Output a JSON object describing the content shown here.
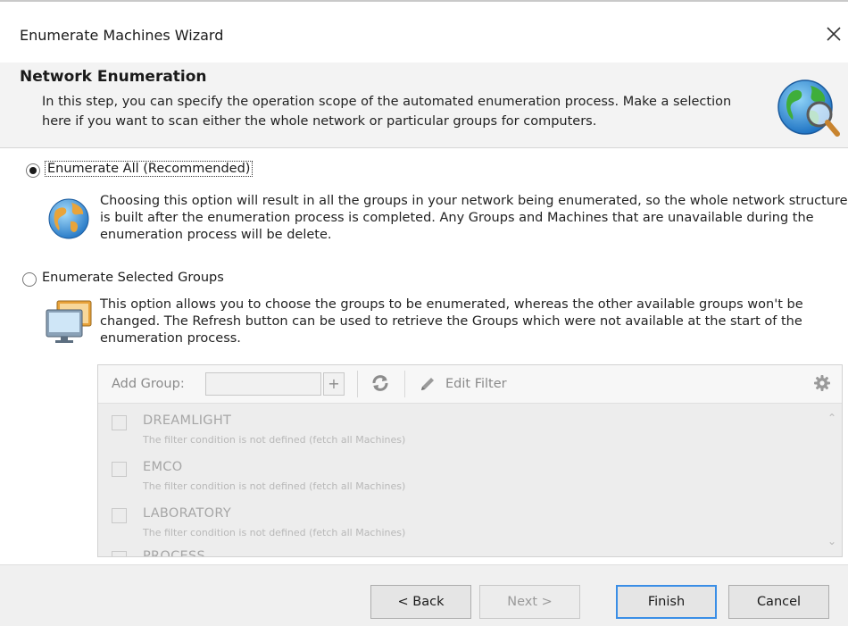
{
  "window": {
    "title": "Enumerate Machines Wizard",
    "close_icon": "close-icon"
  },
  "header": {
    "title": "Network Enumeration",
    "description": "In this step, you can specify the operation scope of the automated enumeration process. Make a selection here if you want to scan either the whole network or particular groups for computers.",
    "icon": "globe-magnifier-icon"
  },
  "options": {
    "enumerate_all": {
      "label": "Enumerate All (Recommended)",
      "selected": true,
      "description": "Choosing this option will result in all the groups in your network being enumerated, so the whole network structure is built after the enumeration process is completed. Any Groups and Machines that are unavailable during the enumeration process will be delete.",
      "icon": "globe-icon"
    },
    "enumerate_selected": {
      "label": "Enumerate Selected Groups",
      "selected": false,
      "description": "This option allows you to choose the groups to be enumerated, whereas the other available groups won't be changed. The Refresh button can be used to retrieve the Groups which were not available at the start of the enumeration process.",
      "icon": "monitors-icon"
    }
  },
  "group_panel": {
    "add_group_label": "Add Group:",
    "add_group_value": "",
    "add_button": "+",
    "edit_filter_label": "Edit Filter",
    "groups": [
      {
        "name": "DREAMLIGHT",
        "subtitle": "The filter condition is not defined (fetch all Machines)"
      },
      {
        "name": "EMCO",
        "subtitle": "The filter condition is not defined (fetch all Machines)"
      },
      {
        "name": "LABORATORY",
        "subtitle": "The filter condition is not defined (fetch all Machines)"
      },
      {
        "name": "PROCESS",
        "subtitle": ""
      }
    ]
  },
  "footer": {
    "back_label": "< Back",
    "next_label": "Next >",
    "finish_label": "Finish",
    "cancel_label": "Cancel"
  },
  "colors": {
    "accent": "#3a8ee6",
    "header_bg": "#f3f3f3",
    "footer_bg": "#f0f0f0"
  }
}
